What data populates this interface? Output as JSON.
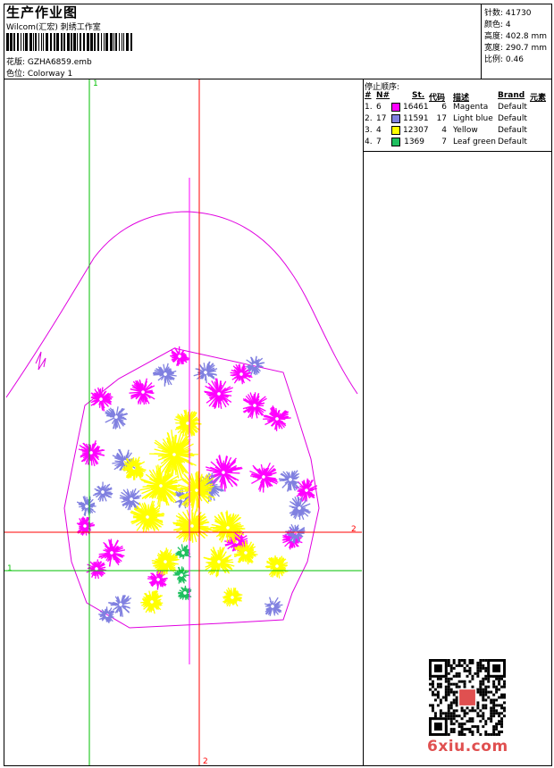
{
  "header": {
    "title": "生产作业图",
    "subtitle": "Wilcom(汇宏) 刺绣工作室",
    "design_line": "花版:  GZHA6859.emb",
    "colorway_line": "色位:  Colorway 1"
  },
  "stats": {
    "stitches": "针数: 41730",
    "colors": "颜色: 4",
    "height": "高度: 402.8 mm",
    "width": "宽度: 290.7 mm",
    "scale": "比例: 0.46"
  },
  "stop_sequence": {
    "title": "停止顺序:",
    "headers": {
      "num": "#",
      "needle": "N#",
      "stitches": "St.",
      "code": "代码",
      "desc": "描述",
      "brand": "Brand",
      "element": "元素"
    },
    "rows": [
      {
        "idx": "1.",
        "needle": "6",
        "color": "#ff00ff",
        "stitches": "16461",
        "code": "6",
        "desc": "Magenta",
        "brand": "Default"
      },
      {
        "idx": "2.",
        "needle": "17",
        "color": "#8080e0",
        "stitches": "11591",
        "code": "17",
        "desc": "Light blue",
        "brand": "Default"
      },
      {
        "idx": "3.",
        "needle": "4",
        "color": "#ffff00",
        "stitches": "12307",
        "code": "4",
        "desc": "Yellow",
        "brand": "Default"
      },
      {
        "idx": "4.",
        "needle": "7",
        "color": "#20c060",
        "stitches": "1369",
        "code": "7",
        "desc": "Leaf green",
        "brand": "Default"
      }
    ]
  },
  "guides": {
    "green_label": "1",
    "red_label": "2"
  },
  "watermark": "6xiu.com",
  "colors": {
    "magenta": "#ff00ff",
    "light_blue": "#8080e0",
    "yellow": "#ffff00",
    "green": "#20c060",
    "guide_red": "#ff0000",
    "guide_green": "#00c000",
    "outline": "#e000e0"
  }
}
